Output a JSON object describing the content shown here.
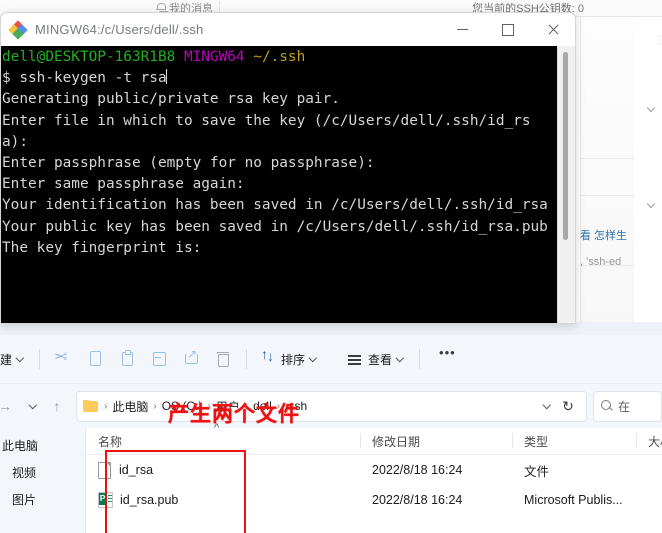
{
  "background_page": {
    "topbar": {
      "messages_label": "我的消息",
      "bell_icon": "bell-icon",
      "ssh_key_count_label": "您当前的SSH公钥数: 0"
    },
    "body_snippets": {
      "link_text": "看 怎样生",
      "code_text": ", 'ssh-ed"
    }
  },
  "terminal": {
    "title": "MINGW64:/c/Users/dell/.ssh",
    "app_icon": "git-bash-icon",
    "window_controls": {
      "minimize": "—",
      "maximize": "☐",
      "close": "✕"
    },
    "prompt": {
      "user_host": "dell@DESKTOP-163R1B8",
      "shell": "MINGW64",
      "path": "~/.ssh",
      "symbol": "$ "
    },
    "command": "ssh-keygen -t rsa",
    "output_lines": [
      "Generating public/private rsa key pair.",
      "Enter file in which to save the key (/c/Users/dell/.ssh/id_rsa):",
      "Enter passphrase (empty for no passphrase):",
      "Enter same passphrase again:",
      "Your identification has been saved in /c/Users/dell/.ssh/id_rsa",
      "Your public key has been saved in /c/Users/dell/.ssh/id_rsa.pub",
      "The key fingerprint is:"
    ],
    "colors": {
      "user_host": "#22b022",
      "shell": "#c000c0",
      "path": "#bfa018",
      "text": "#d8d8d8",
      "background": "#000000"
    }
  },
  "explorer": {
    "toolbar": {
      "new_label": "建",
      "cut_icon": "scissors-icon",
      "copy_icon": "copy-icon",
      "paste_icon": "paste-icon",
      "rename_icon": "rename-icon",
      "share_icon": "share-icon",
      "delete_icon": "trash-icon",
      "sort_label": "排序",
      "view_label": "查看",
      "more_icon": "ellipsis-icon"
    },
    "address": {
      "forward_icon": "arrow-right-icon",
      "history_icon": "chevron-down-icon",
      "up_icon": "arrow-up-icon",
      "folder_icon": "folder-icon",
      "breadcrumbs": [
        "此电脑",
        "OS (C:)",
        "用户",
        "dell",
        ".ssh"
      ],
      "separator": "›",
      "dropdown_icon": "chevron-down-icon",
      "refresh_icon": "refresh-icon",
      "search_icon": "search-icon",
      "search_placeholder": "在"
    },
    "sidebar": {
      "items": [
        "此电脑",
        "视频",
        "图片"
      ]
    },
    "columns": [
      "名称",
      "修改日期",
      "类型",
      "大小"
    ],
    "rows": [
      {
        "icon": "blank-document-icon",
        "name": "id_rsa",
        "date": "2022/8/18 16:24",
        "type": "文件",
        "size": ""
      },
      {
        "icon": "publisher-document-icon",
        "name": "id_rsa.pub",
        "date": "2022/8/18 16:24",
        "type": "Microsoft Publis...",
        "size": ""
      }
    ]
  },
  "annotations": {
    "callout_text": "产生两个文件",
    "callout_color": "#ee1111",
    "highlight_box_color": "#ee1111"
  }
}
